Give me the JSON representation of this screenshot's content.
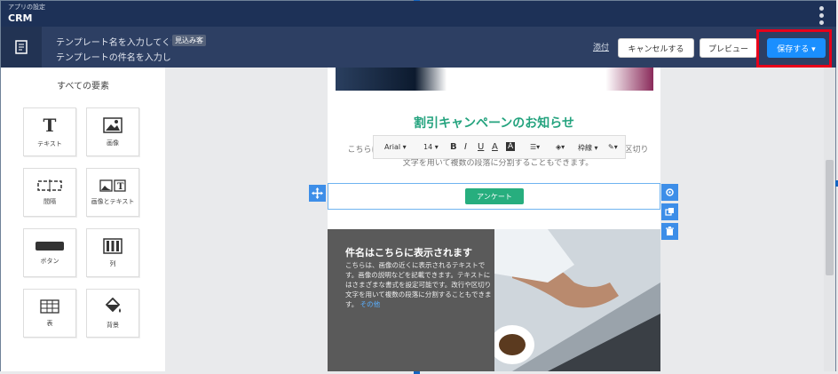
{
  "topbar": {
    "app_subtitle": "アプリの設定",
    "app_name": "CRM"
  },
  "template": {
    "name_placeholder": "テンプレート名を入力してくだ",
    "subject_placeholder": "テンプレートの件名を入力して",
    "badge": "見込み客",
    "attach_link": "添付",
    "cancel_label": "キャンセルする",
    "preview_label": "プレビュー",
    "save_label": "保存する ▾"
  },
  "palette": {
    "title": "すべての要素",
    "items": [
      {
        "label": "テキスト",
        "icon": "text-icon"
      },
      {
        "label": "画像",
        "icon": "image-icon"
      },
      {
        "label": "間隔",
        "icon": "spacer-icon"
      },
      {
        "label": "画像とテキスト",
        "icon": "image-text-icon"
      },
      {
        "label": "ボタン",
        "icon": "button-icon"
      },
      {
        "label": "列",
        "icon": "columns-icon"
      },
      {
        "label": "表",
        "icon": "table-icon"
      },
      {
        "label": "背景",
        "icon": "bucket-icon"
      }
    ]
  },
  "toolbar": {
    "font": "Arial ▾",
    "size": "14 ▾",
    "bold": "B",
    "italic": "I",
    "underline": "U",
    "font_color": "A",
    "bg_color": "A",
    "align": "☰▾",
    "paint": "◈▾",
    "border": "枠線 ▾",
    "brush": "✎▾"
  },
  "email": {
    "headline": "割引キャンペーンのお知らせ",
    "body": "こちらはテキスト欄です。テキストを追加して、書式を設定できます。改行や区切り文字を用いて複数の段落に分割することもできます。",
    "survey_button": "アンケート",
    "feature_title": "件名はこちらに表示されます",
    "feature_text": "こちらは、画像の近くに表示されるテキストです。画像の説明などを記載できます。テキストにはさまざまな書式を設定可能です。改行や区切り文字を用いて複数の段落に分割することもできます。",
    "feature_link": "その他"
  }
}
